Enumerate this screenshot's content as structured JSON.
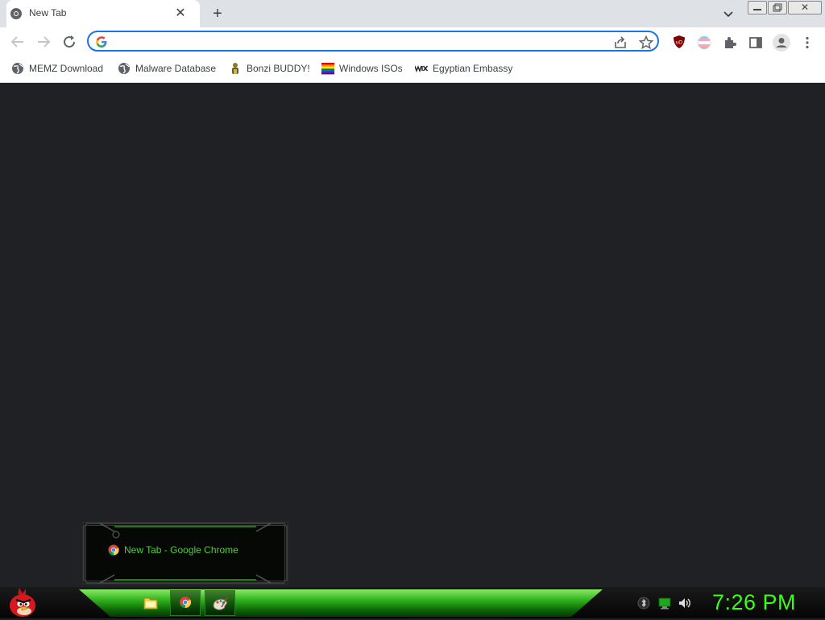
{
  "browser": {
    "tab": {
      "title": "New Tab",
      "close": "✕"
    },
    "new_tab": "+",
    "window_close": "✕",
    "omnibox": {
      "value": "",
      "placeholder": ""
    }
  },
  "bookmarks": [
    {
      "label": "MEMZ Download",
      "icon": "globe-icon"
    },
    {
      "label": "Malware Database",
      "icon": "globe-icon"
    },
    {
      "label": "Bonzi BUDDY!",
      "icon": "bonzi-icon"
    },
    {
      "label": "Windows ISOs",
      "icon": "rainbow-flag-icon"
    },
    {
      "label": "Egyptian Embassy",
      "icon": "wix-icon"
    }
  ],
  "taskbar": {
    "tooltip": "New Tab - Google Chrome",
    "clock": "7:26 PM"
  },
  "colors": {
    "content_bg": "#202124",
    "accent_green": "#39ff14",
    "omnibox_border": "#1a73e8"
  }
}
